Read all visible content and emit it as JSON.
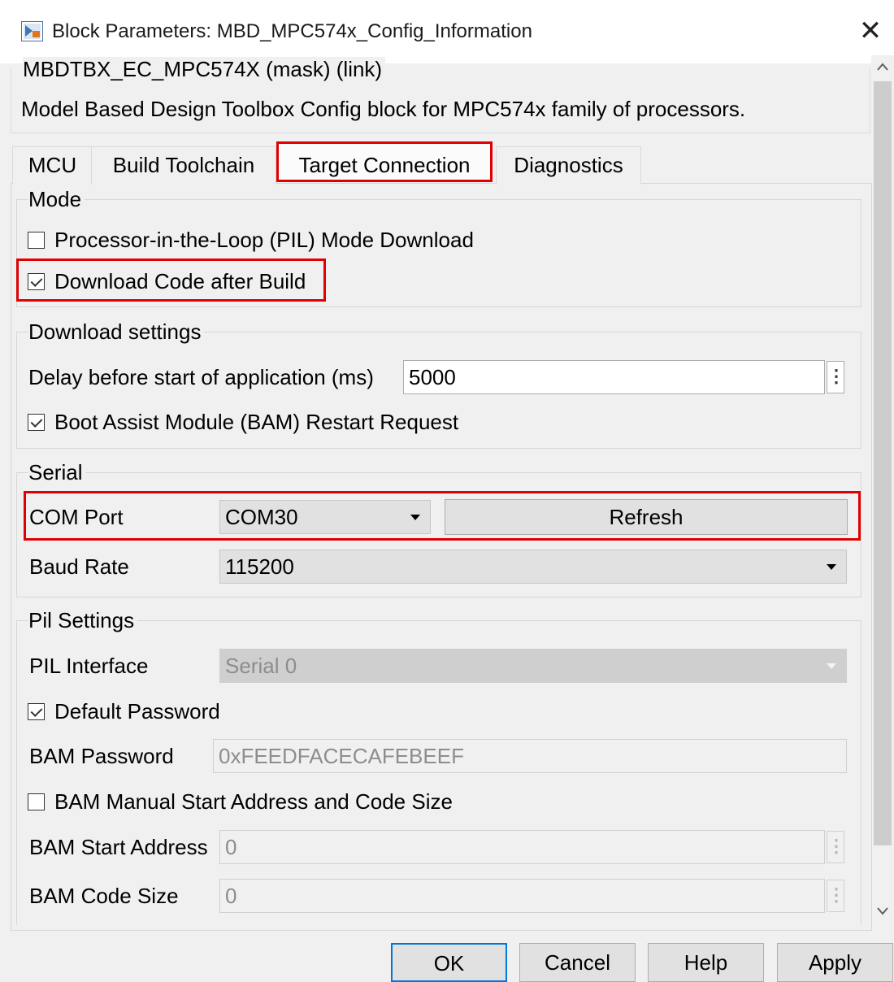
{
  "window": {
    "title": "Block Parameters: MBD_MPC574x_Config_Information",
    "close_glyph": "✕"
  },
  "mask": {
    "title": "MBDTBX_EC_MPC574X (mask) (link)",
    "description": "Model Based Design Toolbox Config block for MPC574x family of processors."
  },
  "tabs": [
    {
      "label": "MCU",
      "active": false
    },
    {
      "label": "Build Toolchain",
      "active": false
    },
    {
      "label": "Target Connection",
      "active": true
    },
    {
      "label": "Diagnostics",
      "active": false
    }
  ],
  "mode": {
    "label": "Mode",
    "pil_download": {
      "label": "Processor-in-the-Loop (PIL) Mode Download",
      "checked": false
    },
    "download_after_build": {
      "label": "Download Code after Build",
      "checked": true
    }
  },
  "download_settings": {
    "label": "Download settings",
    "delay_label": "Delay before start of application (ms)",
    "delay_value": "5000",
    "bam_restart": {
      "label": "Boot Assist Module (BAM) Restart Request",
      "checked": true
    }
  },
  "serial": {
    "label": "Serial",
    "com_port_label": "COM Port",
    "com_port_value": "COM30",
    "refresh_label": "Refresh",
    "baud_label": "Baud Rate",
    "baud_value": "115200"
  },
  "pil_settings": {
    "label": "Pil Settings",
    "interface_label": "PIL Interface",
    "interface_value": "Serial 0",
    "default_password": {
      "label": "Default Password",
      "checked": true
    },
    "bam_password_label": "BAM Password",
    "bam_password_value": "0xFEEDFACECAFEBEEF",
    "manual_start": {
      "label": "BAM Manual Start Address and Code Size",
      "checked": false
    },
    "start_address_label": "BAM Start Address",
    "start_address_value": "0",
    "code_size_label": "BAM Code Size",
    "code_size_value": "0"
  },
  "buttons": {
    "ok": "OK",
    "cancel": "Cancel",
    "help": "Help",
    "apply": "Apply"
  },
  "colors": {
    "highlight": "#e00000",
    "default_button_border": "#0078d7"
  }
}
